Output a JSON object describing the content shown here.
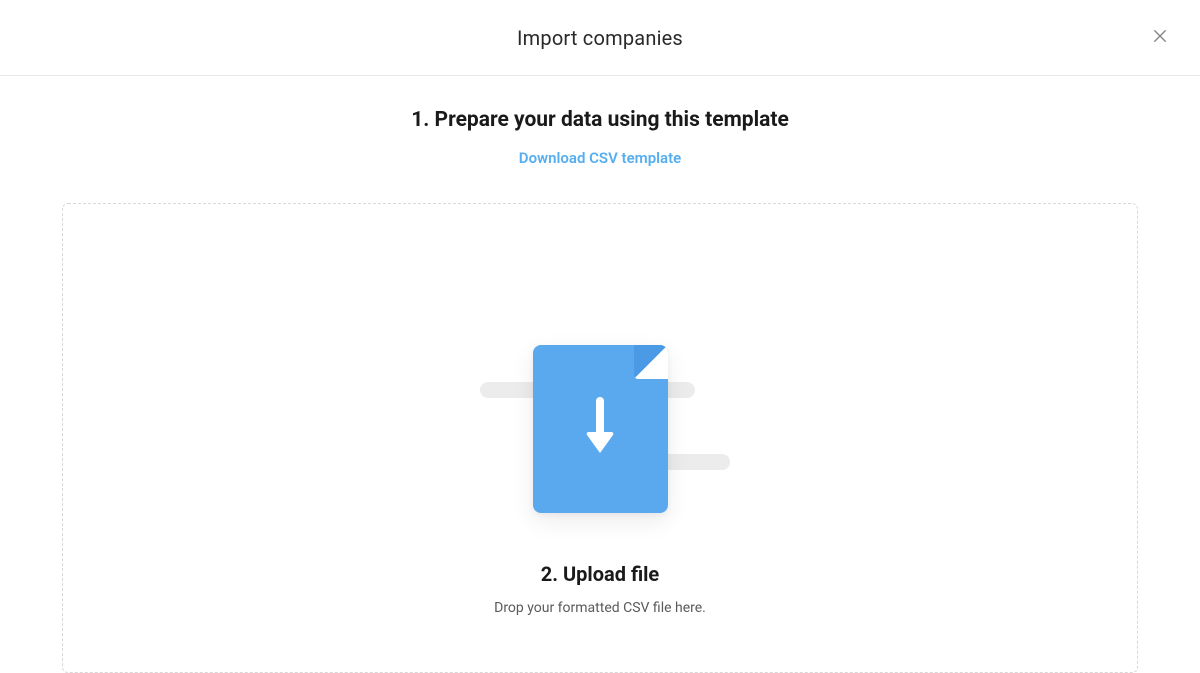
{
  "header": {
    "title": "Import companies"
  },
  "step1": {
    "title": "1. Prepare your data using this template",
    "download_link_label": "Download CSV template"
  },
  "step2": {
    "title": "2. Upload file",
    "subtitle": "Drop your formatted CSV file here."
  },
  "colors": {
    "link": "#54aef0",
    "file_bg": "#5aa9ef"
  }
}
